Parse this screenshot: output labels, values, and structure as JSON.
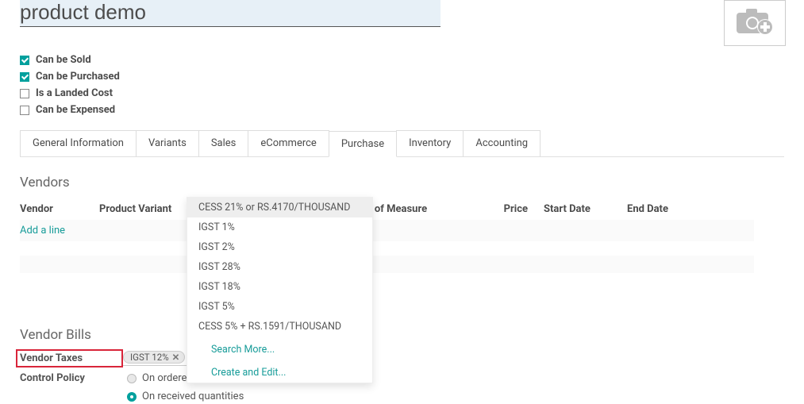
{
  "product": {
    "name": "product demo"
  },
  "options": {
    "sold": {
      "label": "Can be Sold",
      "checked": true
    },
    "purchased": {
      "label": "Can be Purchased",
      "checked": true
    },
    "landed": {
      "label": "Is a Landed Cost",
      "checked": false
    },
    "expensed": {
      "label": "Can be Expensed",
      "checked": false
    }
  },
  "tabs": {
    "general": "General Information",
    "variants": "Variants",
    "sales": "Sales",
    "ecommerce": "eCommerce",
    "purchase": "Purchase",
    "inventory": "Inventory",
    "accounting": "Accounting"
  },
  "vendors": {
    "title": "Vendors",
    "headers": {
      "vendor": "Vendor",
      "variant": "Product Variant",
      "uom": "Unit of Measure",
      "price": "Price",
      "start": "Start Date",
      "end": "End Date"
    },
    "add_line": "Add a line"
  },
  "dropdown": {
    "items": [
      "CESS 21% or RS.4170/THOUSAND",
      "IGST 1%",
      "IGST 2%",
      "IGST 28%",
      "IGST 18%",
      "IGST 5%",
      "CESS 5% + RS.1591/THOUSAND"
    ],
    "search_more": "Search More...",
    "create_edit": "Create and Edit..."
  },
  "vendor_bills": {
    "title": "Vendor Bills",
    "taxes_label": "Vendor Taxes",
    "tax_chip": "IGST 12%",
    "policy_label": "Control Policy",
    "policy_options": {
      "ordered": "On ordered quantities",
      "received": "On received quantities"
    }
  }
}
